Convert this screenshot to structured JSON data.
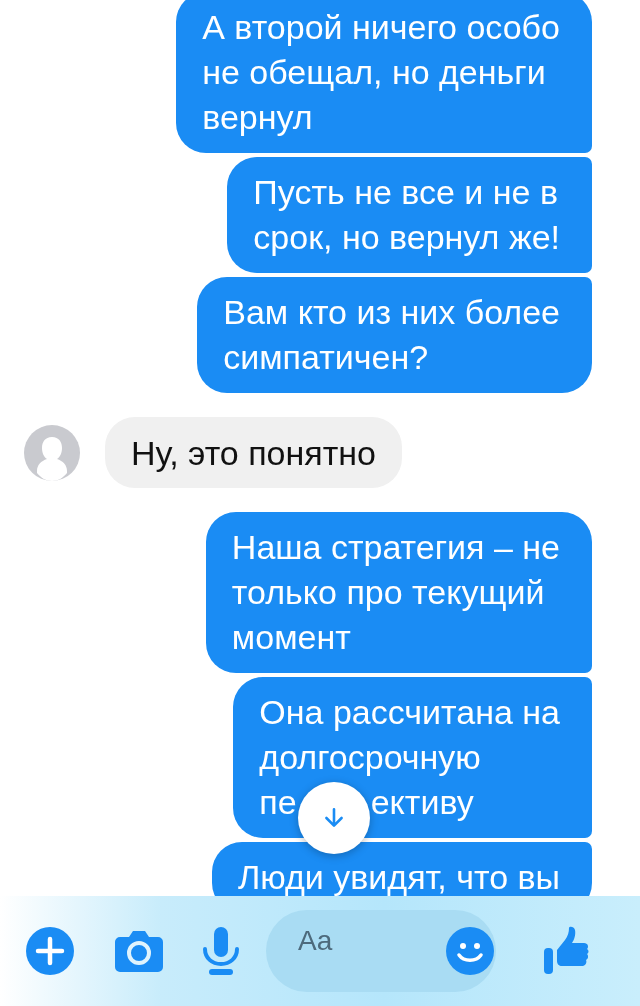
{
  "messages": [
    {
      "kind": "sent",
      "text": "А второй ничего особо\nне обещал, но деньги\nвернул"
    },
    {
      "kind": "sent",
      "text": "Пусть не все и не в\nсрок, но вернул же!"
    },
    {
      "kind": "sent",
      "text": "Вам кто из них более\nсимпатичен?"
    },
    {
      "kind": "received",
      "text": "Ну, это понятно"
    },
    {
      "kind": "sent",
      "text": "Наша стратегия – не\nтолько про текущий\nмомент"
    },
    {
      "kind": "sent",
      "text": "Она рассчитана на\nдолгосрочную",
      "covered_line": [
        "пе",
        "ективу"
      ]
    },
    {
      "kind": "sent",
      "text": "Люди увидят, что вы"
    }
  ],
  "composer": {
    "placeholder": "Aa"
  }
}
